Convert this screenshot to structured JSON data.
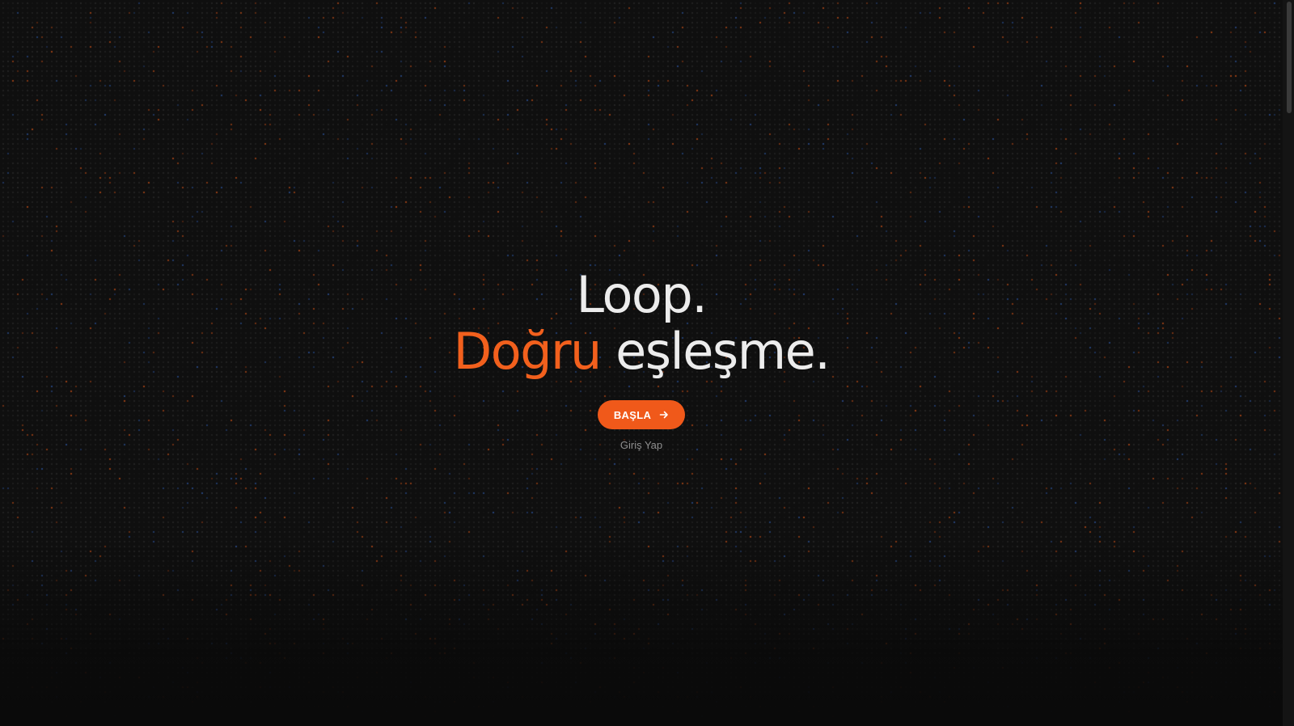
{
  "hero": {
    "title_line1": "Loop.",
    "title_line2_accent": "Doğru",
    "title_line2_rest": "eşleşme.",
    "cta_label": "BAŞLA",
    "cta_icon": "arrow-right-icon",
    "login_label": "Giriş Yap"
  },
  "colors": {
    "background": "#0f0f0f",
    "accent": "#f2601d",
    "text": "#ececec",
    "muted": "#8e8e8e",
    "dot_palette": [
      "#f2601d",
      "#3b6fd1",
      "#4a4a4a"
    ]
  }
}
